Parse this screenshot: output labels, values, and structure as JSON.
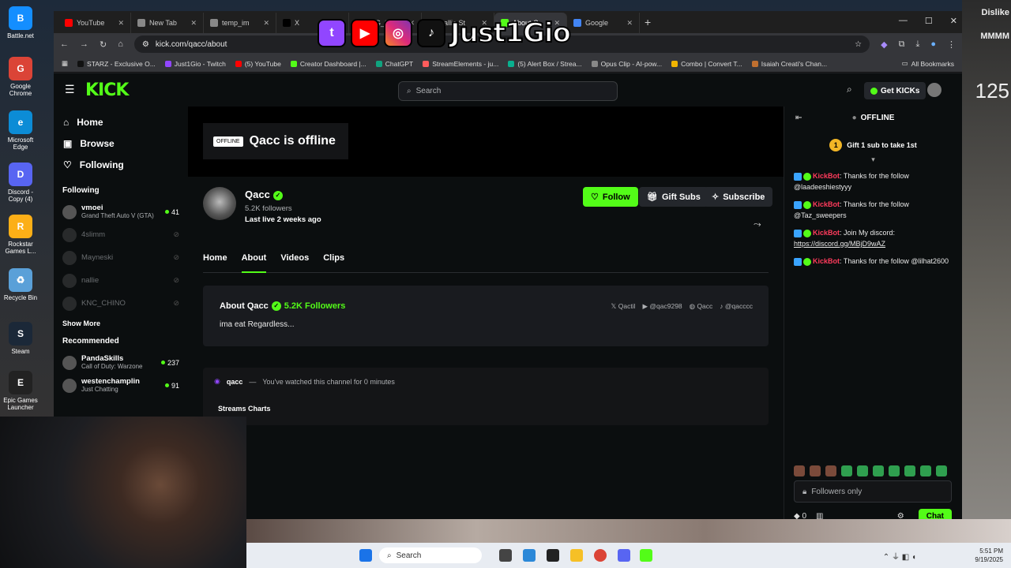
{
  "desktop": {
    "icons": [
      {
        "label": "Battle.net",
        "color": "#148eff",
        "glyph": "B"
      },
      {
        "label": "Google Chrome",
        "color": "#db4437",
        "glyph": "G"
      },
      {
        "label": "Microsoft Edge",
        "color": "#0c8cd6",
        "glyph": "e"
      },
      {
        "label": "Discord - Copy (4)",
        "color": "#5865f2",
        "glyph": "D"
      },
      {
        "label": "Rockstar Games L...",
        "color": "#fcaf17",
        "glyph": "R"
      },
      {
        "label": "Recycle Bin",
        "color": "#5aa0d8",
        "glyph": "♻"
      },
      {
        "label": "Steam",
        "color": "#1b2838",
        "glyph": "S"
      },
      {
        "label": "Epic Games Launcher",
        "color": "#222222",
        "glyph": "E"
      }
    ],
    "right_bg_text": [
      "Dislike",
      "MMMM",
      "125"
    ]
  },
  "browser": {
    "tabs": [
      {
        "label": "YouTube",
        "color": "#ff0000",
        "active": false
      },
      {
        "label": "New Tab",
        "color": "#888888",
        "active": false
      },
      {
        "label": "temp_im",
        "color": "#888888",
        "active": false
      },
      {
        "label": "X",
        "color": "#000000",
        "active": false
      },
      {
        "label": "IMG_03",
        "color": "#888888",
        "active": false
      },
      {
        "label": "nallie St",
        "color": "#53fc18",
        "active": false
      },
      {
        "label": "About C",
        "color": "#53fc18",
        "active": true
      },
      {
        "label": "Google",
        "color": "#4285f4",
        "active": false
      }
    ],
    "url": "kick.com/qacc/about",
    "bookmarks": [
      {
        "label": "STARZ - Exclusive O...",
        "color": "#111111"
      },
      {
        "label": "Just1Gio - Twitch",
        "color": "#9146ff"
      },
      {
        "label": "(5) YouTube",
        "color": "#ff0000"
      },
      {
        "label": "Creator Dashboard |...",
        "color": "#53fc18"
      },
      {
        "label": "ChatGPT",
        "color": "#10a37f"
      },
      {
        "label": "StreamElements - ju...",
        "color": "#ff5c5c"
      },
      {
        "label": "(5) Alert Box / Strea...",
        "color": "#09b08f"
      },
      {
        "label": "Opus Clip - AI-pow...",
        "color": "#888888"
      },
      {
        "label": "Combo | Convert T...",
        "color": "#f0b400"
      },
      {
        "label": "Isaiah Creati's Chan...",
        "color": "#c07030"
      }
    ],
    "all_bookmarks": "All Bookmarks"
  },
  "overlay": {
    "handle": "Just1Gio"
  },
  "kick": {
    "search_placeholder": "Search",
    "get_kicks": "Get KICKs",
    "nav": [
      {
        "label": "Home",
        "icon": "home-icon"
      },
      {
        "label": "Browse",
        "icon": "browse-icon"
      },
      {
        "label": "Following",
        "icon": "heart-icon"
      }
    ],
    "following_heading": "Following",
    "following": [
      {
        "name": "vmoei",
        "game": "Grand Theft Auto V (GTA)",
        "viewers": "41",
        "live": true
      },
      {
        "name": "4slimm",
        "game": "",
        "viewers": "",
        "live": false
      },
      {
        "name": "Mayneski",
        "game": "",
        "viewers": "",
        "live": false
      },
      {
        "name": "nallie",
        "game": "",
        "viewers": "",
        "live": false
      },
      {
        "name": "KNC_CHINO",
        "game": "",
        "viewers": "",
        "live": false
      }
    ],
    "show_more": "Show More",
    "recommended_heading": "Recommended",
    "recommended": [
      {
        "name": "PandaSkills",
        "game": "Call of Duty: Warzone",
        "viewers": "237"
      },
      {
        "name": "westenchamplin",
        "game": "Just Chatting",
        "viewers": "91"
      }
    ],
    "offline_tag": "OFFLINE",
    "offline_title": "Qacc is offline",
    "channel": {
      "name": "Qacc",
      "followers": "5.2K followers",
      "last_live": "Last live 2 weeks ago"
    },
    "buttons": {
      "follow": "Follow",
      "gift": "Gift Subs",
      "subscribe": "Subscribe"
    },
    "tabs": [
      "Home",
      "About",
      "Videos",
      "Clips"
    ],
    "about": {
      "title": "About Qacc",
      "followers": "5.2K Followers",
      "bio": "ima eat Regardless...",
      "socials": [
        "Qactil",
        "@qac9298",
        "Qacc",
        "@qacccc"
      ]
    },
    "watch": {
      "user": "qacc",
      "text": "You've watched this channel for 0 minutes",
      "streams_charts": "Streams Charts"
    },
    "chat": {
      "status": "OFFLINE",
      "gift_text": "Gift 1 sub to take 1st",
      "coin_num": "1",
      "messages": [
        {
          "user": "KickBot",
          "text": ": Thanks for the follow @laadeeshiestyyy",
          "link": ""
        },
        {
          "user": "KickBot",
          "text": ": Thanks for the follow @Taz_sweepers",
          "link": ""
        },
        {
          "user": "KickBot",
          "text": ": Join My discord: ",
          "link": "https://discord.gg/MBjD9wAZ"
        },
        {
          "user": "KickBot",
          "text": ": Thanks for the follow @lilhat2600",
          "link": ""
        }
      ],
      "input_placeholder": "Followers only",
      "count": "0",
      "chat_button": "Chat"
    }
  },
  "taskbar": {
    "search": "Search",
    "time": "5:51 PM",
    "date": "9/19/2025"
  }
}
